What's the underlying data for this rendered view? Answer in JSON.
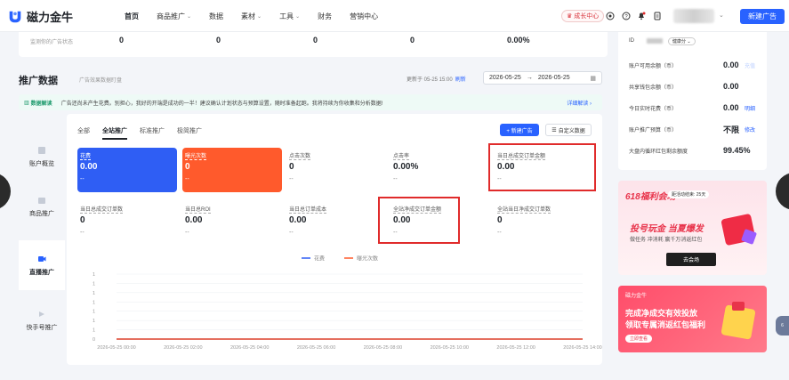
{
  "brand": {
    "name": "磁力金牛",
    "accent": "#2962ff"
  },
  "nav": {
    "items": [
      {
        "label": "首页",
        "active": true,
        "dropdown": false
      },
      {
        "label": "商品推广",
        "dropdown": true
      },
      {
        "label": "数据",
        "dropdown": false
      },
      {
        "label": "素材",
        "dropdown": true
      },
      {
        "label": "工具",
        "dropdown": true
      },
      {
        "label": "财务",
        "dropdown": false
      },
      {
        "label": "营销中心",
        "dropdown": false
      }
    ],
    "growth_center": "成长中心",
    "new_ad": "新建广告"
  },
  "summary": {
    "label": "监测你的广告状态",
    "values": [
      "0",
      "0",
      "0",
      "0",
      "0.00%"
    ]
  },
  "section": {
    "title": "推广数据",
    "subtitle": "广告效果数据盯盘",
    "updated": "更新于 05-25 15:00",
    "refresh": "刷新",
    "date_start": "2026-05-25",
    "date_sep": "→",
    "date_end": "2026-05-25"
  },
  "diagnosis": {
    "badge": "数据解读",
    "text": "广告还尚未产生花费。别担心，我好的开端是成功的一半！建议确认计划状态与预算设置，随时准备起跑。我将持续为你收集和分析数据!",
    "link": "详细解读 ›"
  },
  "side_tabs": [
    {
      "label": "账户概览",
      "icon": "account-overview-icon",
      "active": false
    },
    {
      "label": "商品推广",
      "icon": "product-promo-icon",
      "active": false
    },
    {
      "label": "直播推广",
      "icon": "live-promo-icon",
      "active": true
    },
    {
      "label": "快手号推广",
      "icon": "kuaishou-promo-icon",
      "active": false
    }
  ],
  "sub_tabs": [
    {
      "label": "全部",
      "active": false
    },
    {
      "label": "全站推广",
      "active": true
    },
    {
      "label": "标准推广",
      "active": false
    },
    {
      "label": "极简推广",
      "active": false
    }
  ],
  "panel_buttons": {
    "new_ad": "+ 新建广告",
    "custom": "自定义数据"
  },
  "metrics_row1": [
    {
      "label": "花费",
      "value": "0.00",
      "sub": "--"
    },
    {
      "label": "曝光次数",
      "value": "0",
      "sub": "--"
    },
    {
      "label": "点击次数",
      "value": "0",
      "sub": "--"
    },
    {
      "label": "点击率",
      "value": "0.00%",
      "sub": "--"
    },
    {
      "label": "当日总成交订单金额",
      "value": "0.00",
      "sub": "--"
    }
  ],
  "metrics_row2": [
    {
      "label": "当日总成交订单数",
      "value": "0",
      "sub": "--"
    },
    {
      "label": "当日总ROI",
      "value": "0.00",
      "sub": "--"
    },
    {
      "label": "当日总订单成本",
      "value": "0.00",
      "sub": "--"
    },
    {
      "label": "全站净成交订单金额",
      "value": "0.00",
      "sub": "--"
    },
    {
      "label": "全站当日净成交订单数",
      "value": "0",
      "sub": "--"
    }
  ],
  "chart_data": {
    "type": "line",
    "series": [
      {
        "name": "花费",
        "color": "#2f5ef4",
        "values": [
          0,
          0,
          0,
          0,
          0,
          0,
          0,
          0
        ]
      },
      {
        "name": "曝光次数",
        "color": "#ff5a2c",
        "values": [
          0,
          0,
          0,
          0,
          0,
          0,
          0,
          0
        ]
      }
    ],
    "x": [
      "2026-05-25 00:00",
      "2026-05-25 02:00",
      "2026-05-25 04:00",
      "2026-05-25 06:00",
      "2026-05-25 08:00",
      "2026-05-25 10:00",
      "2026-05-25 12:00",
      "2026-05-25 14:00"
    ],
    "yticks": [
      "1",
      "1",
      "1",
      "1",
      "1",
      "1",
      "1",
      "0"
    ],
    "legend_position": "top-center",
    "grid": true
  },
  "right_panel": {
    "id_label": "ID",
    "role": "健康分",
    "rows": [
      {
        "label": "账户可用余额（币）",
        "value": "0.00",
        "link": "充值",
        "faded": true
      },
      {
        "label": "共享钱包余额（币）",
        "value": "0.00",
        "link": ""
      },
      {
        "label": "今日实时花费（币）",
        "value": "0.00",
        "link": "明细"
      },
      {
        "label": "账户推广预算（币）",
        "value": "不限",
        "link": "修改"
      },
      {
        "label": "大盘内循环红包剩余额度",
        "value": "99.45%",
        "link": ""
      }
    ]
  },
  "banner1": {
    "title": "618福利会场",
    "time": "距活动结束: 25天",
    "headline": "投号玩金 当夏爆发",
    "sub": "做任务 冲消耗 赢千万消返红包",
    "button": "去会场"
  },
  "banner2": {
    "logo": "磁力金牛",
    "line1": "完成净成交有效投放",
    "line2": "领取专属消返红包福利",
    "button": "立即查看"
  },
  "float": "6"
}
